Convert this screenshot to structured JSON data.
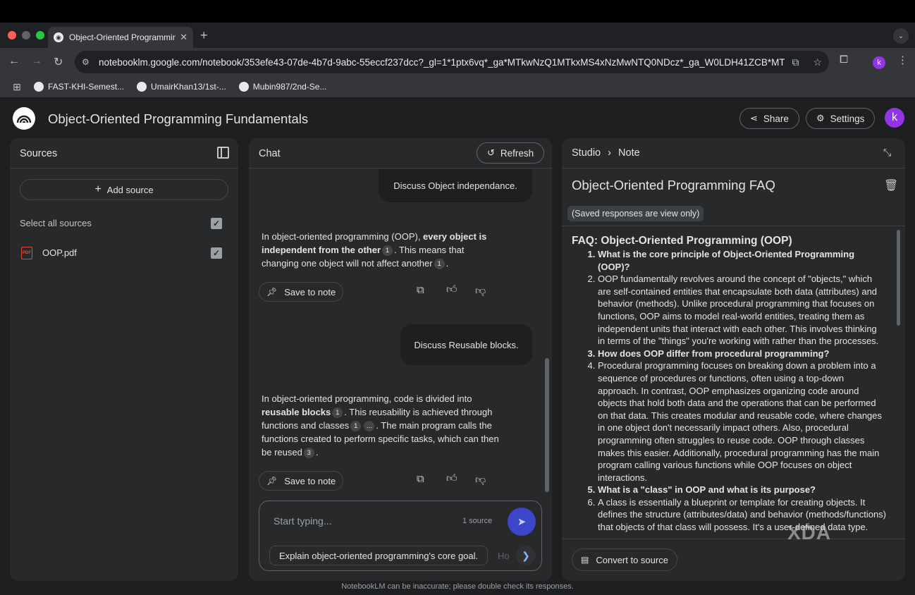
{
  "browser": {
    "tab_title": "Object-Oriented Programming",
    "url": "notebooklm.google.com/notebook/353efe43-07de-4b7d-9abc-55eccf237dcc?_gl=1*1ptx6vq*_ga*MTkwNzQ1MTkxMS4xNzMwNTQ0NDcz*_ga_W0LDH41ZCB*MT...",
    "profile_initial": "k",
    "bookmarks": [
      "FAST-KHI-Semest...",
      "UmairKhan13/1st-...",
      "Mubin987/2nd-Se..."
    ]
  },
  "header": {
    "title": "Object-Oriented Programming Fundamentals",
    "share_label": "Share",
    "settings_label": "Settings",
    "avatar_initial": "k"
  },
  "sources": {
    "title": "Sources",
    "add_source_label": "Add source",
    "select_all_label": "Select all sources",
    "items": [
      {
        "name": "OOP.pdf",
        "badge": "PDF"
      }
    ]
  },
  "chat": {
    "title": "Chat",
    "refresh_label": "Refresh",
    "user_msg_1": "Discuss Object independance.",
    "resp1": {
      "a": "In object-oriented programming (OOP), ",
      "b": "every object is independent from the other",
      "c": ". This means that changing one object will not affect another",
      "d": "."
    },
    "user_msg_2": "Discuss Reusable blocks.",
    "resp2": {
      "a": "In object-oriented programming, code is divided into ",
      "b": "reusable blocks",
      "c": ". This reusability is achieved through functions and classes",
      "d": ". The main program calls the functions created to perform specific tasks, which can then be reused",
      "e": "."
    },
    "citations": {
      "one": "1",
      "three": "3",
      "more": "..."
    },
    "save_to_note_label": "Save to note",
    "input_placeholder": "Start typing...",
    "source_count": "1 source",
    "suggestion": "Explain object-oriented programming's core goal.",
    "suggestion_next_partial": "Ho"
  },
  "studio": {
    "crumb_studio": "Studio",
    "crumb_note": "Note",
    "note_title": "Object-Oriented Programming FAQ",
    "view_only_label": "(Saved responses are view only)",
    "faq_heading": "FAQ: Object-Oriented Programming (OOP)",
    "items": [
      {
        "text": "What is the core principle of Object-Oriented Programming (OOP)?",
        "bold": true
      },
      {
        "text": "OOP fundamentally revolves around the concept of \"objects,\" which are self-contained entities that encapsulate both data (attributes) and behavior (methods). Unlike procedural programming that focuses on functions, OOP aims to model real-world entities, treating them as independent units that interact with each other. This involves thinking in terms of the \"things\" you're working with rather than the processes.",
        "bold": false
      },
      {
        "text": "How does OOP differ from procedural programming?",
        "bold": true
      },
      {
        "text": "Procedural programming focuses on breaking down a problem into a sequence of procedures or functions, often using a top-down approach. In contrast, OOP emphasizes organizing code around objects that hold both data and the operations that can be performed on that data. This creates modular and reusable code, where changes in one object don't necessarily impact others. Also, procedural programming often struggles to reuse code. OOP through classes makes this easier. Additionally, procedural programming has the main program calling various functions while OOP focuses on object interactions.",
        "bold": false
      },
      {
        "text": "What is a \"class\" in OOP and what is its purpose?",
        "bold": true
      },
      {
        "text": "A class is essentially a blueprint or template for creating objects. It defines the structure (attributes/data) and behavior (methods/functions) that objects of that class will possess. It's a user-defined data type. The main purpose of a class is to...",
        "bold": false
      }
    ],
    "convert_label": "Convert to source"
  },
  "watermark": "XDA",
  "footer": "NotebookLM can be inaccurate; please double check its responses."
}
